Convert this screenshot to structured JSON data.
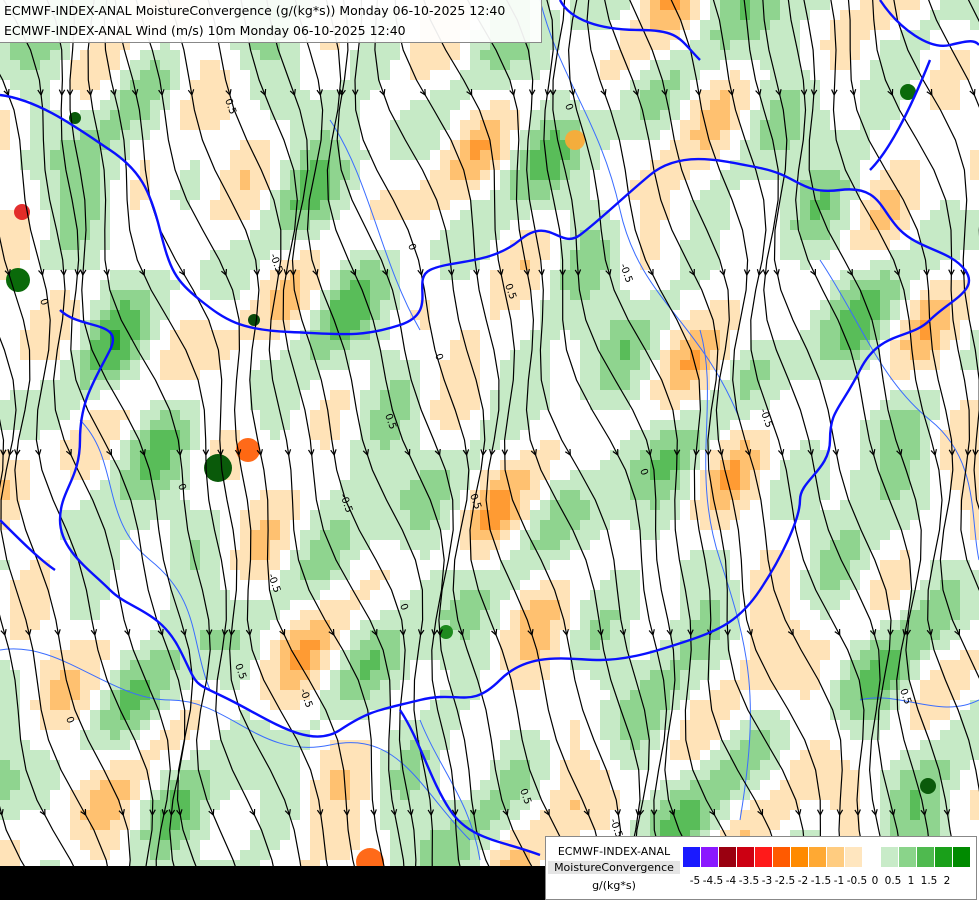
{
  "header": {
    "line1": "ECMWF-INDEX-ANAL MoistureConvergence (g/(kg*s)) Monday 06-10-2025 12:40",
    "line2": "ECMWF-INDEX-ANAL Wind (m/s) 10m Monday 06-10-2025 12:40"
  },
  "legend": {
    "model": "ECMWF-INDEX-ANAL",
    "variable": "MoistureConvergence",
    "unit": "g/(kg*s)",
    "ticks": [
      "-5",
      "-4.5",
      "-4",
      "-3.5",
      "-3",
      "-2.5",
      "-2",
      "-1.5",
      "-1",
      "-0.5",
      "0",
      "0.5",
      "1",
      "1.5",
      "2"
    ],
    "colors": [
      "#1a1aff",
      "#8a18ff",
      "#9a0010",
      "#cc0012",
      "#ff1a1a",
      "#ff5a00",
      "#ff8a00",
      "#ffa933",
      "#ffcc80",
      "#ffe6bf",
      "#ffffff",
      "#c8ebc8",
      "#8ad48a",
      "#4fba4f",
      "#1aa01a",
      "#008a00"
    ]
  },
  "contour_labels": [
    "0",
    "0.5",
    "-0.5",
    "0",
    "0.5",
    "-0.5",
    "0",
    "0.5",
    "-0.5",
    "0",
    "0.5",
    "-0.5"
  ],
  "colors": {
    "border": "#0a10ff",
    "river": "#3a6cff",
    "streamline": "#000000"
  }
}
